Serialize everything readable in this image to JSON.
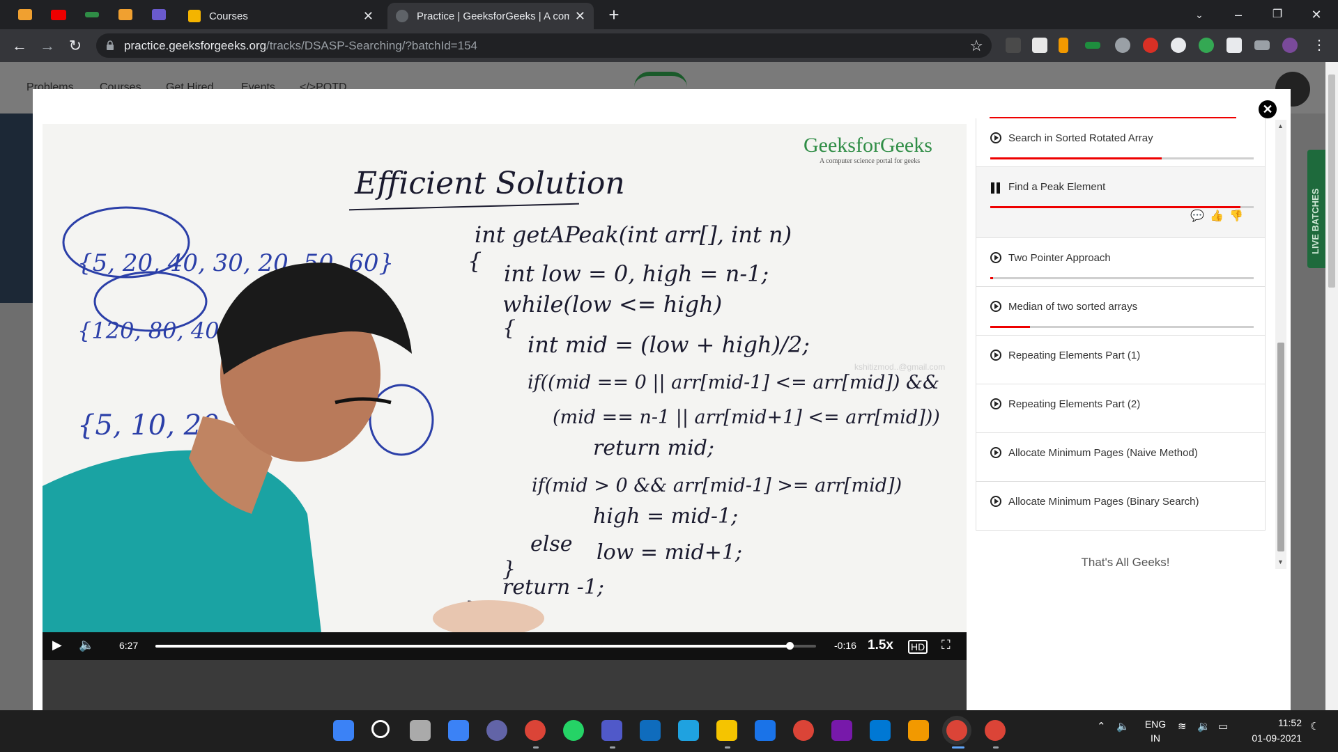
{
  "browser": {
    "tabs": [
      {
        "title": "Courses"
      },
      {
        "title": "Practice | GeeksforGeeks | A computer science portal for geeks"
      }
    ],
    "url_host": "practice.geeksforgeeks.org",
    "url_path": "/tracks/DSASP-Searching/?batchId=154"
  },
  "site_nav": [
    "Problems",
    "Courses",
    "Get Hired",
    "Events",
    "</>POTD"
  ],
  "live_tab": "LIVE BATCHES",
  "video": {
    "watermark": "GeeksforGeeks",
    "watermark_tag": "A computer science portal for geeks",
    "email_watermark": "kshitizmod..@gmail.com",
    "board": {
      "title": "Efficient Solution",
      "code": [
        "int getAPeak(int arr[], int n)",
        "{",
        "int low = 0, high = n-1;",
        "while(low <= high)",
        "{",
        "int mid = (low + high)/2;",
        "if((mid == 0 || arr[mid-1] <= arr[mid]) &&",
        "(mid == n-1 || arr[mid+1] <= arr[mid]))",
        "return mid;",
        "if(mid > 0 && arr[mid-1] >= arr[mid])",
        "high = mid-1;",
        "else",
        "low = mid+1;",
        "}",
        "return -1;",
        "}"
      ],
      "arrays": [
        "{5, 20, 40, 30, 20, 50, 60}",
        "{120, 80, 40",
        "{5, 10, 20"
      ]
    },
    "current_time": "6:27",
    "remaining_time": "-0:16",
    "progress": 0.96,
    "playback_rate": "1.5x"
  },
  "playlist": {
    "items": [
      {
        "title": "Search in Sorted Rotated Array",
        "state": "play",
        "progress": 0.65
      },
      {
        "title": "Find a Peak Element",
        "state": "pause",
        "progress": 0.95
      },
      {
        "title": "Two Pointer Approach",
        "state": "play",
        "progress": 0.01
      },
      {
        "title": "Median of two sorted arrays",
        "state": "play",
        "progress": 0.15
      },
      {
        "title": "Repeating Elements Part (1)",
        "state": "play",
        "progress": null
      },
      {
        "title": "Repeating Elements Part (2)",
        "state": "play",
        "progress": null
      },
      {
        "title": "Allocate Minimum Pages (Naive Method)",
        "state": "play",
        "progress": null
      },
      {
        "title": "Allocate Minimum Pages (Binary Search)",
        "state": "play",
        "progress": null
      }
    ],
    "footer": "That's All Geeks!"
  },
  "taskbar": {
    "lang": "ENG",
    "region": "IN",
    "time": "11:52",
    "date": "01-09-2021"
  },
  "colors": {
    "gfg_green": "#2f8d46",
    "progress_red": "#e00000",
    "chrome_dark": "#202124",
    "chrome_toolbar": "#35363a"
  }
}
